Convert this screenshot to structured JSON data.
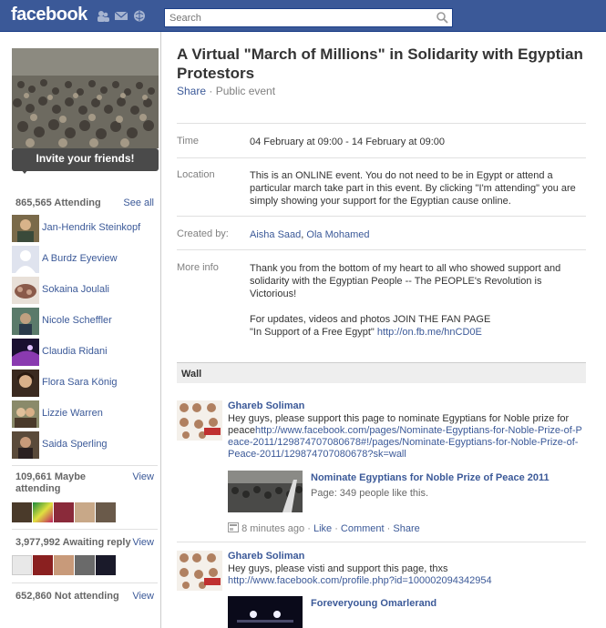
{
  "topbar": {
    "logo": "facebook",
    "search_placeholder": "Search"
  },
  "sidebar": {
    "invite_label": "Invite your friends!",
    "attending_count": "865,565 Attending",
    "see_all": "See all",
    "attendees": [
      {
        "name": "Jan-Hendrik Steinkopf"
      },
      {
        "name": "A Burdz Eyeview"
      },
      {
        "name": "Sokaina Joulali"
      },
      {
        "name": "Nicole Scheffler"
      },
      {
        "name": "Claudia Ridani"
      },
      {
        "name": "Flora Sara König"
      },
      {
        "name": "Lizzie Warren"
      },
      {
        "name": "Saida Sperling"
      }
    ],
    "maybe_label": "109,661 Maybe attending",
    "maybe_view": "View",
    "awaiting_label": "3,977,992 Awaiting reply",
    "awaiting_view": "View",
    "not_attending_label": "652,860 Not attending",
    "not_attending_view": "View"
  },
  "event": {
    "title": "A Virtual \"March of Millions\" in Solidarity with Egyptian Protestors",
    "share_link": "Share",
    "privacy": " · Public event",
    "time_label": "Time",
    "time_value": "04 February at 09:00 - 14 February at 09:00",
    "location_label": "Location",
    "location_value": "This is an ONLINE event. You do not need to be in Egypt or attend a particular march take part in this event. By clicking \"I'm attending\" you are simply showing your support for the Egyptian cause online.",
    "created_label": "Created by:",
    "creator_1": "Aisha Saad",
    "creator_sep": ", ",
    "creator_2": "Ola Mohamed",
    "moreinfo_label": "More info",
    "moreinfo_p1": "Thank you from the bottom of my heart to all who showed support and solidarity with the Egyptian People -- The PEOPLE's Revolution is Victorious!",
    "moreinfo_p2a": "For updates, videos and photos JOIN THE FAN PAGE",
    "moreinfo_p2b": "\"In Support of a Free Egypt\" ",
    "moreinfo_link": "http://on.fb.me/hnCD0E"
  },
  "wall": {
    "heading": "Wall",
    "posts": [
      {
        "author": "Ghareb Soliman",
        "text": "Hey guys, please support this page to nominate Egyptians for Noble prize for peace",
        "link": "http://www.facebook.com/pages/Nominate-Egyptians-for-Noble-Prize-of-Peace-2011/129874707080678#!/pages/Nominate-Egyptians-for-Noble-Prize-of-Peace-2011/129874707080678?sk=wall",
        "attachment_title": "Nominate Egyptians for Noble Prize of Peace 2011",
        "attachment_sub": "Page: 349 people like this.",
        "time": "8 minutes ago",
        "like": "Like",
        "comment": "Comment",
        "share": "Share"
      },
      {
        "author": "Ghareb Soliman",
        "text": "Hey guys, please visti and support this page, thxs",
        "link": "http://www.facebook.com/profile.php?id=100002094342954",
        "attachment_title": "Foreveryoung Omarlerand"
      }
    ]
  },
  "colors": {
    "brand": "#3b5998",
    "brand_dark": "#133783",
    "wall_bg": "#eeeeee"
  }
}
